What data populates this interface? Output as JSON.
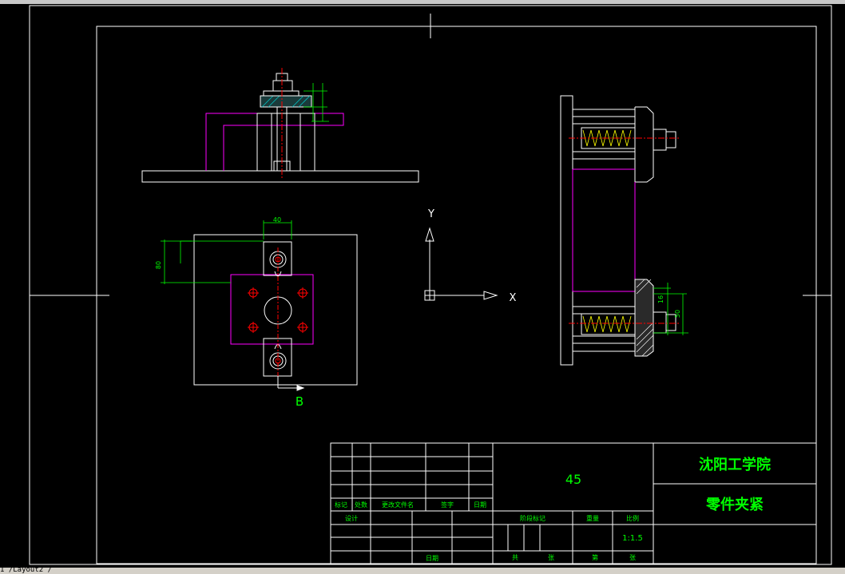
{
  "title_block": {
    "institution": "沈阳工学院",
    "drawing_title": "零件夹紧",
    "material": "45",
    "scale_label": "比例",
    "scale_value": "1:1.5",
    "stage_mark_label": "阶段标记",
    "weight_label": "重量",
    "sheet_total_label": "共",
    "sheet_label": "张",
    "sheet_num_label": "第",
    "sheet_num_label2": "张",
    "col_mark": "标记",
    "col_count": "处数",
    "col_doc": "更改文件名",
    "col_sign": "签字",
    "col_date": "日期",
    "designer_label": "设计",
    "date_label": "日期"
  },
  "dimensions": {
    "top_width": "40",
    "left_height": "80",
    "right_small": "16",
    "right_large": "50"
  },
  "view_label": "B",
  "ucs": {
    "x_label": "X",
    "y_label": "Y"
  },
  "status_text": "1 /Layout2 /",
  "colors": {
    "background": "#000000",
    "outline": "#ffffff",
    "hidden": "#ff00ff",
    "dimension": "#00ff00",
    "center": "#ff0000",
    "thread": "#ffff00"
  }
}
